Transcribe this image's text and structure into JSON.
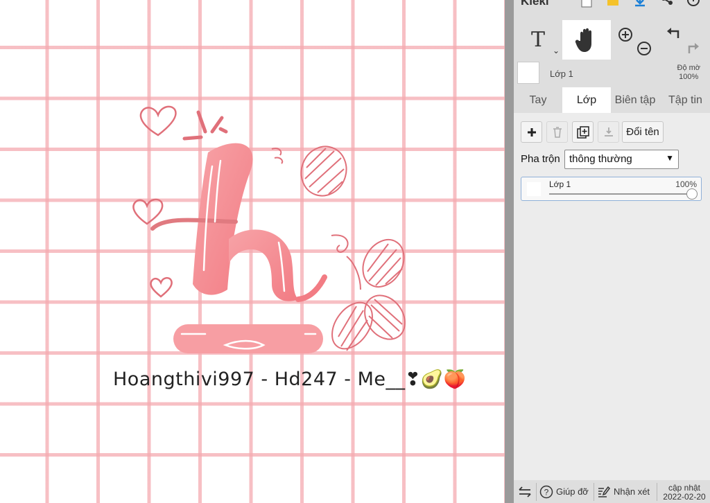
{
  "app": {
    "name": "Kleki"
  },
  "canvas": {
    "signature_text": "Hoangthivi997 - Hd247 - Me__",
    "signature_emoji": "❣🥑🍑",
    "colors": {
      "grid": "#f4aab0",
      "letter": "#f58a8f",
      "doodle": "#e0707a"
    }
  },
  "toolbar": {
    "text_tool_label": "T",
    "tools": [
      "text-tool",
      "hand-tool",
      "zoom-in",
      "zoom-out",
      "undo",
      "redo"
    ],
    "active_tool": "hand-tool"
  },
  "layer_header": {
    "name": "Lớp 1",
    "opacity_label": "Độ mờ",
    "opacity_value": "100%"
  },
  "tabs": [
    {
      "label": "Tay",
      "active": false
    },
    {
      "label": "Lớp",
      "active": true
    },
    {
      "label": "Biên tập",
      "active": false
    },
    {
      "label": "Tập tin",
      "active": false
    }
  ],
  "layer_panel": {
    "add_icon": "plus-icon",
    "delete_icon": "trash-icon",
    "duplicate_icon": "duplicate-icon",
    "merge_icon": "merge-down-icon",
    "rename_label": "Đổi tên",
    "blend_label": "Pha trộn",
    "blend_value": "thông thường",
    "layers": [
      {
        "name": "Lớp 1",
        "opacity": "100%",
        "opacity_fraction": 1.0
      }
    ]
  },
  "footer": {
    "help_label": "Giúp đỡ",
    "feedback_label": "Nhận xét",
    "update_label": "cập nhật",
    "update_date": "2022-02-20"
  }
}
